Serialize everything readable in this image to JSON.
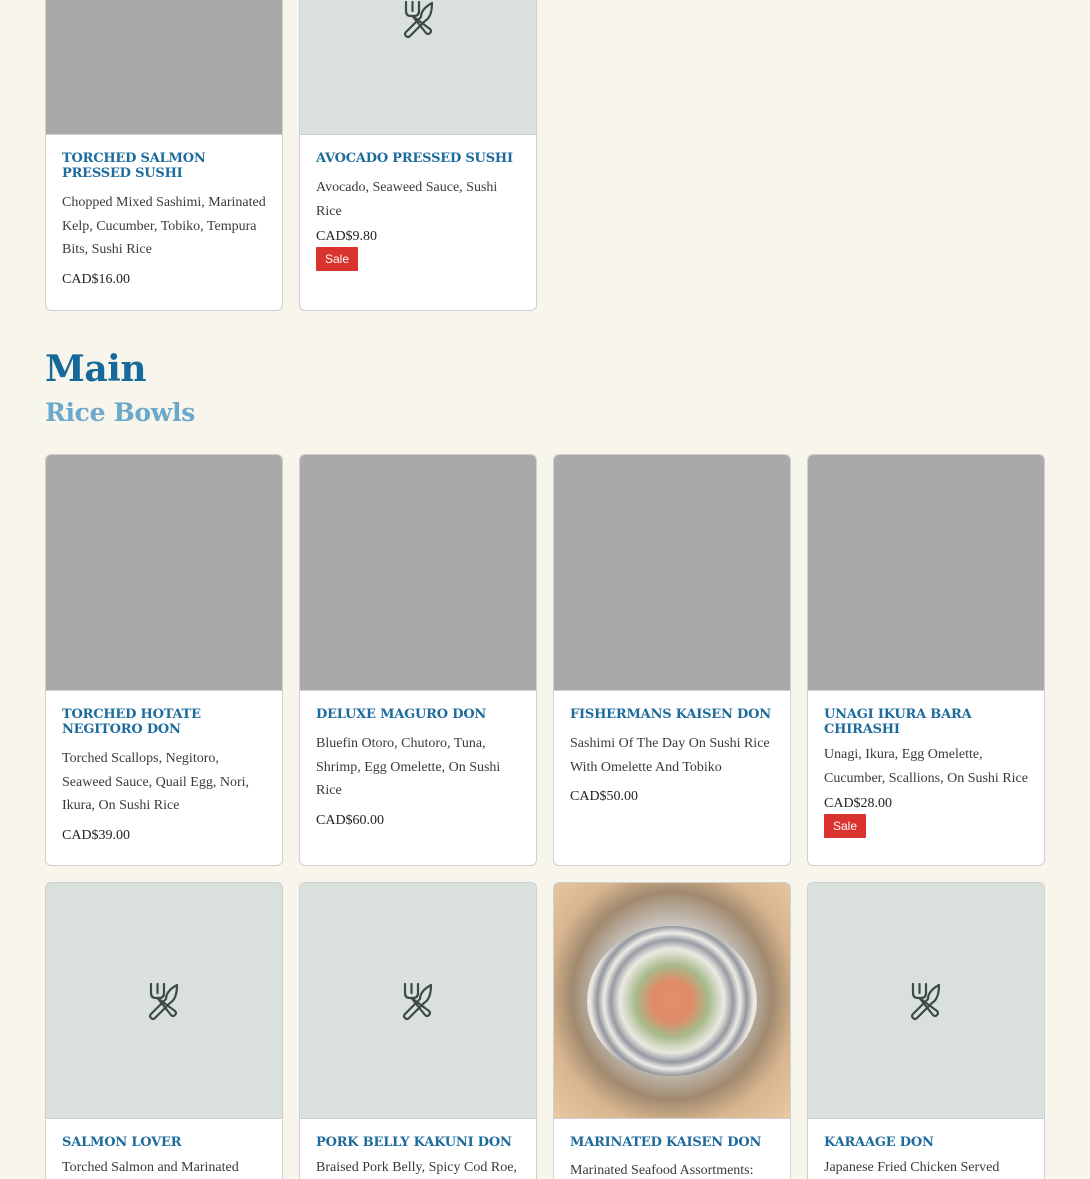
{
  "top_row": [
    {
      "title": "TORCHED SALMON PRESSED SUSHI",
      "desc": "Chopped Mixed Sashimi, Marinated Kelp, Cucumber, Tobiko, Tempura Bits, Sushi Rice",
      "price": "CAD$16.00",
      "image": "gray-placeholder"
    },
    {
      "title": "AVOCADO PRESSED SUSHI",
      "desc": "Avocado, Seaweed Sauce, Sushi Rice",
      "price": "CAD$9.80",
      "badge": "Sale",
      "image": "utensils-icon"
    }
  ],
  "section": {
    "title": "Main"
  },
  "subsection": {
    "title": "Rice Bowls"
  },
  "row1": [
    {
      "title": "TORCHED HOTATE NEGITORO DON",
      "desc": "Torched Scallops, Negitoro, Seaweed Sauce, Quail Egg, Nori, Ikura, On Sushi Rice",
      "price": "CAD$39.00"
    },
    {
      "title": "DELUXE MAGURO DON",
      "desc": "Bluefin Otoro, Chutoro, Tuna, Shrimp, Egg Omelette, On Sushi Rice",
      "price": "CAD$60.00"
    },
    {
      "title": "FISHERMANS KAISEN DON",
      "desc": "Sashimi Of The Day On Sushi Rice With Omelette And Tobiko",
      "price": "CAD$50.00"
    },
    {
      "title": "UNAGI IKURA BARA CHIRASHI",
      "desc": "Unagi, Ikura, Egg Omelette, Cucumber, Scallions, On Sushi Rice",
      "price": "CAD$28.00",
      "badge": "Sale"
    }
  ],
  "row2": [
    {
      "title": "SALMON LOVER",
      "desc": "Torched Salmon and Marinated",
      "image": "utensils-icon"
    },
    {
      "title": "PORK BELLY KAKUNI DON",
      "desc": "Braised Pork Belly, Spicy Cod Roe,",
      "image": "utensils-icon"
    },
    {
      "title": "MARINATED KAISEN DON",
      "desc": "Marinated Seafood Assortments:",
      "image": "food-photo"
    },
    {
      "title": "KARAAGE DON",
      "desc": "Japanese Fried Chicken Served",
      "image": "utensils-icon"
    }
  ],
  "colors": {
    "background": "#f7f5ec",
    "title_blue": "#1d6b9c",
    "subtitle_blue": "#6aa9cc",
    "sale_red": "#d9322f",
    "placeholder_gray": "#a9a9a9",
    "placeholder_mint": "#dae1dc"
  }
}
